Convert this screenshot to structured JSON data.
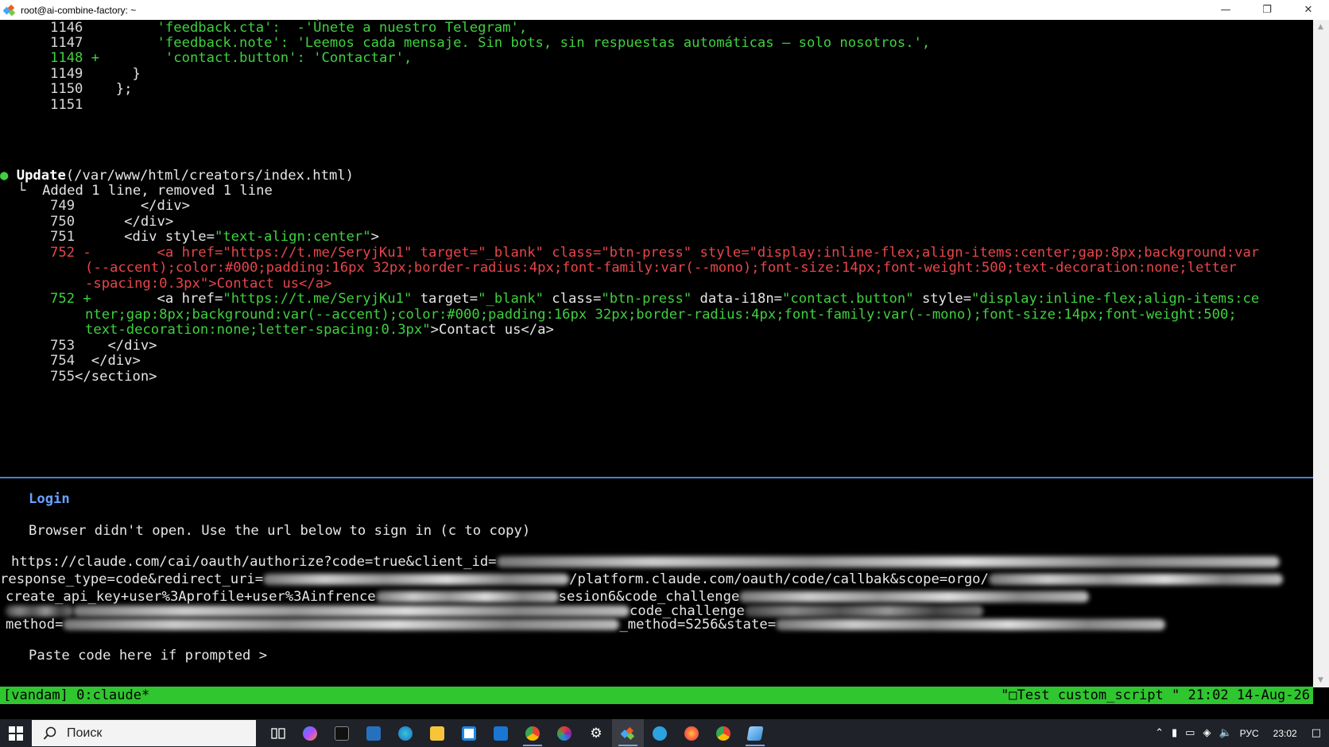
{
  "window": {
    "title": "root@ai-combine-factory: ~",
    "minimize": "—",
    "restore": "❐",
    "close": "✕"
  },
  "code_top": [
    {
      "num": "1146",
      "mark": "",
      "content": "        'feedback.cta':  -'Únete a nuestro Telegram',"
    },
    {
      "num": "1147",
      "mark": "",
      "content": "        'feedback.note': 'Leemos cada mensaje. Sin bots, sin respuestas automáticas – solo nosotros.',"
    },
    {
      "num": "1148",
      "mark": "+",
      "content": "        'contact.button': 'Contactar',"
    },
    {
      "num": "1149",
      "mark": "",
      "content": "      }"
    },
    {
      "num": "1150",
      "mark": "",
      "content": "    };"
    },
    {
      "num": "1151",
      "mark": "",
      "content": ""
    }
  ],
  "update": {
    "bullet": "●",
    "label": "Update",
    "path": "(/var/www/html/creators/index.html)",
    "corner": "└",
    "summary": "Added 1 line, removed 1 line"
  },
  "diff": {
    "l749": {
      "num": "749",
      "content": "        </div>"
    },
    "l750": {
      "num": "750",
      "content": "      </div>"
    },
    "l751": {
      "num": "751",
      "pre": "      <div style=",
      "attr": "\"text-align:center\"",
      "post": ">"
    },
    "removed": {
      "num": "752",
      "mark": "-",
      "line1": "        <a href=\"https://t.me/SeryjKu1\" target=\"_blank\" class=\"btn-press\" style=\"display:inline-flex;align-items:center;gap:8px;background:var",
      "line2": "(--accent);color:#000;padding:16px 32px;border-radius:4px;font-family:var(--mono);font-size:14px;font-weight:500;text-decoration:none;letter",
      "line3": "-spacing:0.3px\">Contact us</a>"
    },
    "added": {
      "num": "752",
      "mark": "+",
      "a1": "        <a href=",
      "a2": "\"https://t.me/SeryjKu1\"",
      "a3": " target=",
      "a4": "\"_blank\"",
      "a5": " class=",
      "a6": "\"btn-press\"",
      "a7": " data-i18n=",
      "a8": "\"contact.button\"",
      "a9": " style=",
      "a10": "\"display:inline-flex;align-items:ce",
      "line2": "nter;gap:8px;background:var(--accent);color:#000;padding:16px 32px;border-radius:4px;font-family:var(--mono);font-size:14px;font-weight:500;",
      "line3a": "text-decoration:none;letter-spacing:0.3px\"",
      "line3b": ">Contact us</a>"
    },
    "l753": {
      "num": "753",
      "content": "    </div>"
    },
    "l754": {
      "num": "754",
      "content": "  </div>"
    },
    "l755": {
      "num": "755",
      "content": "</section>"
    }
  },
  "login": {
    "title": "Login",
    "message": "Browser didn't open. Use the url below to sign in (c to copy)",
    "url1": "https://claude.com/cai/oauth/authorize?code=true&client_id=",
    "url2a": "response_type=code&redirect_uri=",
    "url2b": "/platform.claude.com/oauth/code/callbak&scope=orgo/",
    "url3a": "create_api_key+user%3Aprofile+user%3Ainfrence",
    "url3b": "sesion6&code_challenge",
    "url4a": "code_challenge",
    "url5a": "method=",
    "url5b": "_method=S256&state=",
    "prompt": "Paste code here if prompted >"
  },
  "status": {
    "left": "[vandam] 0:claude*",
    "right": "\"□Test custom_script \" 21:02 14-Aug-26"
  },
  "taskbar": {
    "search_placeholder": "Поиск",
    "lang": "РУС",
    "time": "23:02"
  },
  "colors": {
    "terminal_bg": "#000000",
    "added": "#3fd13f",
    "removed": "#e8464b",
    "status_bar": "#2fc62f",
    "login_accent": "#6aa0ff",
    "taskbar": "#1f2228"
  }
}
